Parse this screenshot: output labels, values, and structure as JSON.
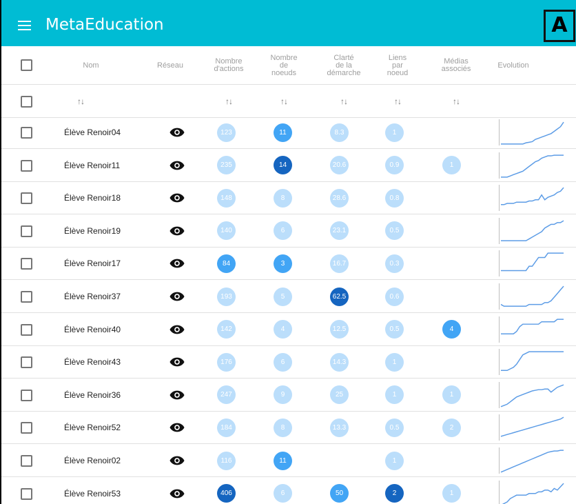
{
  "app": {
    "title": "MetaEducation",
    "corner_badge": "A"
  },
  "header": {
    "nom": "Nom",
    "reseau": "Réseau",
    "actions": [
      "Nombre",
      "d'actions"
    ],
    "noeuds": [
      "Nombre",
      "de",
      "noeuds"
    ],
    "clarte": [
      "Clarté",
      "de la",
      "démarche"
    ],
    "liens": [
      "Liens",
      "par",
      "noeud"
    ],
    "medias": [
      "Médias",
      "associés"
    ],
    "evolution": "Evolution"
  },
  "sort_icon": "sort-arrows-icon",
  "colors": {
    "bar": "#00bcd4",
    "light": "#bbdefb",
    "mid": "#42a5f5",
    "dark": "#1565c0",
    "spark": "#5c9ce6"
  },
  "rows": [
    {
      "name": "Élève Renoir04",
      "actions": {
        "v": "123",
        "l": "light"
      },
      "noeuds": {
        "v": "11",
        "l": "mid"
      },
      "clarte": {
        "v": "8.3",
        "l": "light"
      },
      "liens": {
        "v": "1",
        "l": "light"
      },
      "medias": null,
      "spark": [
        0,
        0,
        0,
        0,
        0,
        0,
        0,
        0,
        2,
        3,
        4,
        8,
        10,
        12,
        14,
        16,
        18,
        22,
        26,
        30,
        38
      ]
    },
    {
      "name": "Élève Renoir11",
      "actions": {
        "v": "235",
        "l": "light"
      },
      "noeuds": {
        "v": "14",
        "l": "dark"
      },
      "clarte": {
        "v": "20.6",
        "l": "light"
      },
      "liens": {
        "v": "0.9",
        "l": "light"
      },
      "medias": {
        "v": "1",
        "l": "light"
      },
      "spark": [
        0,
        0,
        0,
        2,
        4,
        6,
        8,
        10,
        14,
        18,
        22,
        26,
        28,
        32,
        34,
        36,
        36,
        37,
        37,
        37,
        37
      ]
    },
    {
      "name": "Élève Renoir18",
      "actions": {
        "v": "148",
        "l": "light"
      },
      "noeuds": {
        "v": "8",
        "l": "light"
      },
      "clarte": {
        "v": "28.6",
        "l": "light"
      },
      "liens": {
        "v": "0.8",
        "l": "light"
      },
      "medias": null,
      "spark": [
        4,
        4,
        5,
        5,
        5,
        6,
        6,
        6,
        6,
        7,
        7,
        8,
        8,
        12,
        8,
        10,
        11,
        12,
        14,
        15,
        18
      ]
    },
    {
      "name": "Élève Renoir19",
      "actions": {
        "v": "140",
        "l": "light"
      },
      "noeuds": {
        "v": "6",
        "l": "light"
      },
      "clarte": {
        "v": "23.1",
        "l": "light"
      },
      "liens": {
        "v": "0.5",
        "l": "light"
      },
      "medias": null,
      "spark": [
        1,
        1,
        1,
        1,
        1,
        1,
        1,
        1,
        1,
        2,
        3,
        4,
        5,
        6,
        8,
        9,
        10,
        10,
        11,
        11,
        12
      ]
    },
    {
      "name": "Élève Renoir17",
      "actions": {
        "v": "84",
        "l": "mid"
      },
      "noeuds": {
        "v": "3",
        "l": "mid"
      },
      "clarte": {
        "v": "16.7",
        "l": "light"
      },
      "liens": {
        "v": "0.3",
        "l": "light"
      },
      "medias": null,
      "spark": [
        1,
        1,
        1,
        1,
        1,
        1,
        1,
        1,
        1,
        2,
        2,
        3,
        4,
        4,
        4,
        5,
        5,
        5,
        5,
        5,
        5
      ]
    },
    {
      "name": "Élève Renoir37",
      "actions": {
        "v": "193",
        "l": "light"
      },
      "noeuds": {
        "v": "5",
        "l": "light"
      },
      "clarte": {
        "v": "62.5",
        "l": "dark"
      },
      "liens": {
        "v": "0.6",
        "l": "light"
      },
      "medias": null,
      "spark": [
        2,
        1,
        1,
        1,
        1,
        1,
        1,
        1,
        1,
        2,
        2,
        2,
        2,
        2,
        3,
        3,
        4,
        6,
        8,
        10,
        12
      ]
    },
    {
      "name": "Élève Renoir40",
      "actions": {
        "v": "142",
        "l": "light"
      },
      "noeuds": {
        "v": "4",
        "l": "light"
      },
      "clarte": {
        "v": "12.5",
        "l": "light"
      },
      "liens": {
        "v": "0.5",
        "l": "light"
      },
      "medias": {
        "v": "4",
        "l": "mid"
      },
      "spark": [
        3,
        3,
        3,
        3,
        3,
        4,
        6,
        7,
        7,
        7,
        7,
        7,
        7,
        8,
        8,
        8,
        8,
        8,
        9,
        9,
        9
      ]
    },
    {
      "name": "Élève Renoir43",
      "actions": {
        "v": "176",
        "l": "light"
      },
      "noeuds": {
        "v": "6",
        "l": "light"
      },
      "clarte": {
        "v": "14.3",
        "l": "light"
      },
      "liens": {
        "v": "1",
        "l": "light"
      },
      "medias": null,
      "spark": [
        2,
        2,
        2,
        3,
        4,
        6,
        9,
        12,
        13,
        14,
        14,
        14,
        14,
        14,
        14,
        14,
        14,
        14,
        14,
        14,
        14
      ]
    },
    {
      "name": "Élève Renoir36",
      "actions": {
        "v": "247",
        "l": "light"
      },
      "noeuds": {
        "v": "9",
        "l": "light"
      },
      "clarte": {
        "v": "25",
        "l": "light"
      },
      "liens": {
        "v": "1",
        "l": "light"
      },
      "medias": {
        "v": "1",
        "l": "light"
      },
      "spark": [
        0,
        2,
        4,
        8,
        12,
        16,
        18,
        20,
        22,
        24,
        26,
        27,
        28,
        28,
        29,
        29,
        24,
        28,
        32,
        34,
        36
      ]
    },
    {
      "name": "Élève Renoir52",
      "actions": {
        "v": "184",
        "l": "light"
      },
      "noeuds": {
        "v": "8",
        "l": "light"
      },
      "clarte": {
        "v": "13.3",
        "l": "light"
      },
      "liens": {
        "v": "0.5",
        "l": "light"
      },
      "medias": {
        "v": "2",
        "l": "light"
      },
      "spark": [
        3,
        4,
        5,
        6,
        7,
        8,
        9,
        10,
        11,
        12,
        13,
        14,
        15,
        16,
        17,
        18,
        19,
        20,
        21,
        22,
        24
      ]
    },
    {
      "name": "Élève Renoir02",
      "actions": {
        "v": "116",
        "l": "light"
      },
      "noeuds": {
        "v": "11",
        "l": "mid"
      },
      "clarte": null,
      "liens": {
        "v": "1",
        "l": "light"
      },
      "medias": null,
      "spark": [
        0,
        2,
        4,
        6,
        8,
        10,
        12,
        14,
        16,
        18,
        20,
        22,
        24,
        26,
        28,
        30,
        31,
        32,
        32,
        33,
        33
      ]
    },
    {
      "name": "Élève Renoir53",
      "actions": {
        "v": "406",
        "l": "dark"
      },
      "noeuds": {
        "v": "6",
        "l": "light"
      },
      "clarte": {
        "v": "50",
        "l": "mid"
      },
      "liens": {
        "v": "2",
        "l": "dark"
      },
      "medias": {
        "v": "1",
        "l": "light"
      },
      "spark": [
        0,
        2,
        4,
        8,
        10,
        12,
        12,
        12,
        12,
        14,
        14,
        14,
        16,
        16,
        18,
        18,
        16,
        20,
        18,
        22,
        26
      ]
    }
  ]
}
